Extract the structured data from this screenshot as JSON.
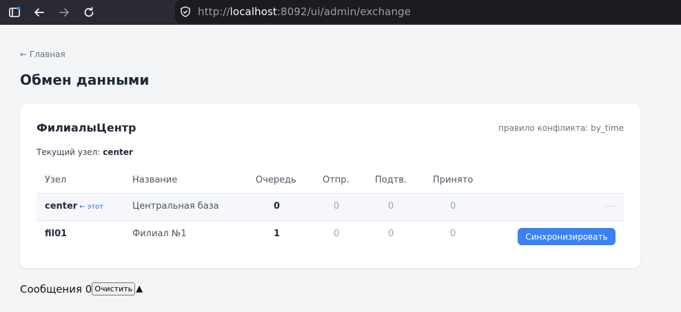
{
  "browser": {
    "url_prefix": "http://",
    "url_host": "localhost",
    "url_rest": ":8092/ui/admin/exchange"
  },
  "nav": {
    "back_label": "← Главная"
  },
  "page": {
    "title": "Обмен данными"
  },
  "card": {
    "title": "ФилиалыЦентр",
    "conflict_label": "правило конфликта: by_time",
    "current_node_label": "Текущий узел:",
    "current_node_value": "center"
  },
  "table": {
    "headers": {
      "node": "Узел",
      "name": "Название",
      "queue": "Очередь",
      "sent": "Отпр.",
      "confirmed": "Подтв.",
      "received": "Принято"
    },
    "rows": [
      {
        "node": "center",
        "this_tag": "← этот",
        "name": "Центральная база",
        "queue": "0",
        "sent": "0",
        "confirmed": "0",
        "received": "0",
        "action": "—"
      },
      {
        "node": "fil01",
        "name": "Филиал №1",
        "queue": "1",
        "sent": "0",
        "confirmed": "0",
        "received": "0",
        "action": "Синхронизировать"
      }
    ]
  },
  "messages": {
    "label": "Сообщения 0",
    "clear_label": "Очистить",
    "toggle_glyph": "▲"
  }
}
